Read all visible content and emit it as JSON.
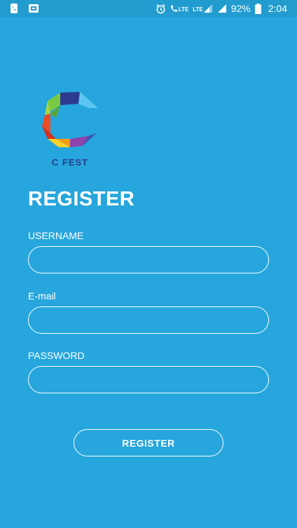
{
  "status_bar": {
    "left_icons": [
      "phone-icon",
      "screenshot-icon"
    ],
    "right_icons": [
      "alarm-icon",
      "volte-call-icon",
      "lte-signal-icon",
      "signal-icon",
      "battery-icon"
    ],
    "lte_label": "LTE",
    "battery_percent": "92%",
    "time": "2:04"
  },
  "logo": {
    "text": "C FEST",
    "colors": [
      "#7ac943",
      "#e94e24",
      "#fbd22c",
      "#8e44ad",
      "#2c3b8f",
      "#5bc5f2"
    ]
  },
  "form": {
    "title": "REGISTER",
    "fields": [
      {
        "label": "USERNAME",
        "value": "",
        "placeholder": ""
      },
      {
        "label": "E-mail",
        "value": "",
        "placeholder": ""
      },
      {
        "label": "PASSWORD",
        "value": "",
        "placeholder": ""
      }
    ],
    "submit_label": "REGISTER"
  },
  "colors": {
    "background": "#26a6dc",
    "status_bar": "#229ccf",
    "foreground": "#ffffff",
    "logo_text": "#2c3b8f"
  }
}
